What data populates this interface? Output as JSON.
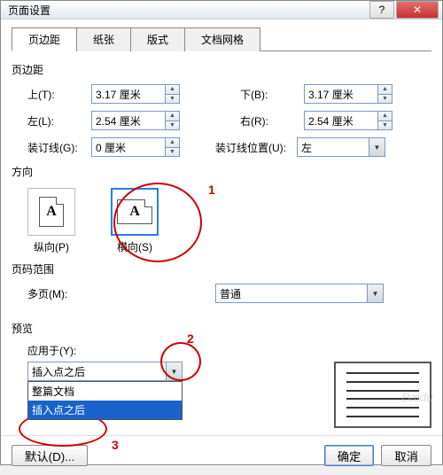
{
  "window": {
    "title": "页面设置"
  },
  "tabs": [
    "页边距",
    "纸张",
    "版式",
    "文档网格"
  ],
  "margins": {
    "section_label": "页边距",
    "top_label": "上(T):",
    "top_value": "3.17 厘米",
    "bottom_label": "下(B):",
    "bottom_value": "3.17 厘米",
    "left_label": "左(L):",
    "left_value": "2.54 厘米",
    "right_label": "右(R):",
    "right_value": "2.54 厘米",
    "gutter_label": "装订线(G):",
    "gutter_value": "0 厘米",
    "gutter_pos_label": "装订线位置(U):",
    "gutter_pos_value": "左"
  },
  "orientation": {
    "section_label": "方向",
    "portrait_label": "纵向(P)",
    "landscape_label": "横向(S)",
    "selected": "landscape"
  },
  "page_range": {
    "section_label": "页码范围",
    "multi_label": "多页(M):",
    "multi_value": "普通"
  },
  "preview": {
    "section_label": "预览",
    "apply_label": "应用于(Y):",
    "apply_value": "插入点之后",
    "options": [
      "整篇文档",
      "插入点之后"
    ],
    "selected_option": "插入点之后"
  },
  "footer": {
    "default_label": "默认(D)...",
    "ok_label": "确定",
    "cancel_label": "取消"
  },
  "annotations": {
    "n1": "1",
    "n2": "2",
    "n3": "3"
  },
  "watermark": "Baidu"
}
